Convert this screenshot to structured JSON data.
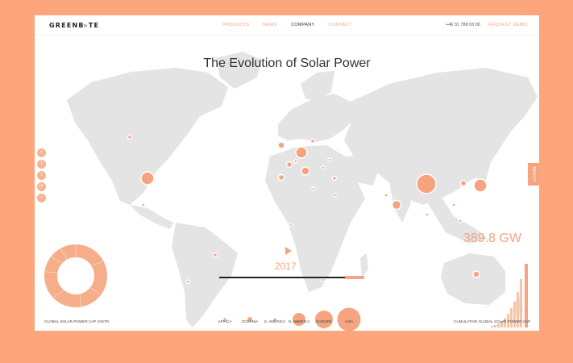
{
  "header": {
    "logo": "GREENB▹TE",
    "nav": [
      "PRODUCTS",
      "NEWS",
      "COMPANY",
      "CONTACT"
    ],
    "active_nav": "COMPANY",
    "phone": "+46 31 788 03 00",
    "cta": "REQUEST DEMO"
  },
  "title": "The Evolution of Solar Power",
  "side_tab": "ABOUT",
  "social_icons": [
    "share-icon",
    "facebook-icon",
    "twitter-icon",
    "linkedin-icon",
    "instagram-icon"
  ],
  "timeline": {
    "year": "2017",
    "progress": 0.87
  },
  "regions": [
    {
      "label": "AFRICA",
      "relative_size": 0.12
    },
    {
      "label": "OCEANIA",
      "relative_size": 0.22
    },
    {
      "label": "S. AMERICA",
      "relative_size": 0.12
    },
    {
      "label": "N. AMERICA",
      "relative_size": 0.55
    },
    {
      "label": "EUROPE",
      "relative_size": 0.75
    },
    {
      "label": "ASIA",
      "relative_size": 1.0
    }
  ],
  "total": {
    "value": "389.8",
    "unit": "GW"
  },
  "labels": {
    "donut": "GLOBAL SOLAR POWER CAP. DISTR.",
    "cumulative": "CUMULATIVE GLOBAL SOLAR POWER CAP."
  },
  "colors": {
    "background": "#FDA57B",
    "accent": "#F5A47F",
    "land": "#E3E3E3",
    "text": "#333333"
  }
}
